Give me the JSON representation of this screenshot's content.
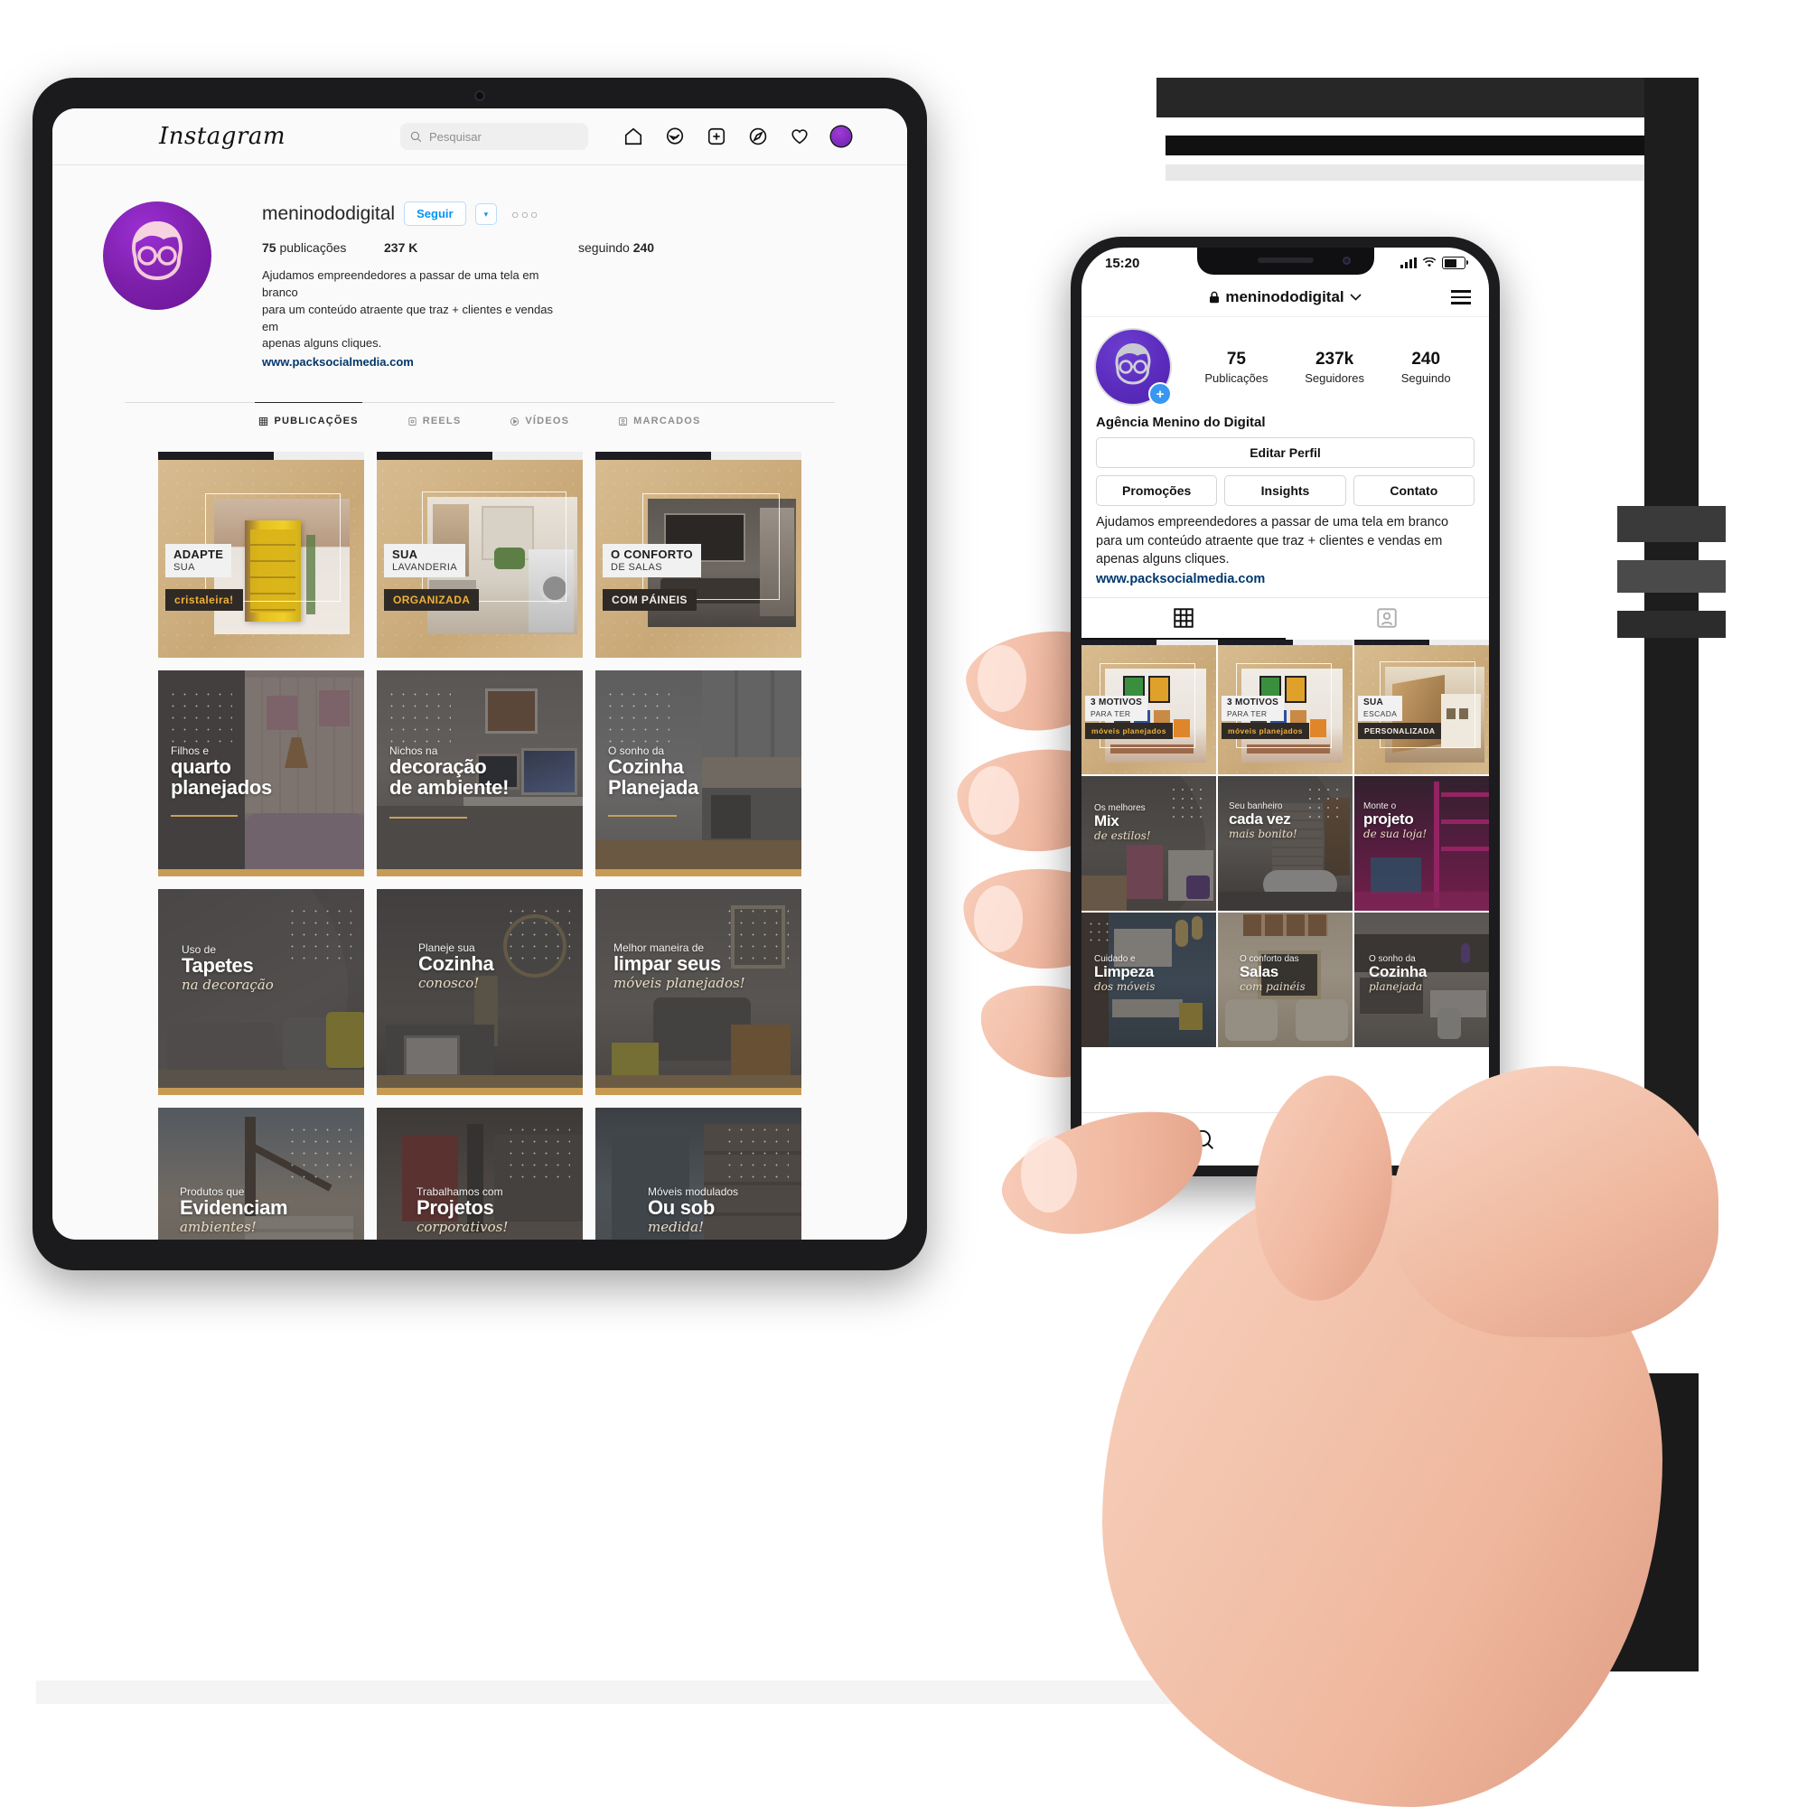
{
  "tablet": {
    "topbar": {
      "logo": "Instagram",
      "search_placeholder": "Pesquisar",
      "icons": [
        "home-icon",
        "messenger-icon",
        "new-post-icon",
        "explore-icon",
        "activity-icon",
        "profile-avatar-icon"
      ]
    },
    "profile": {
      "username": "meninododigital",
      "follow_button": "Seguir",
      "caret_button": "▾",
      "more_button": "○○○",
      "posts_count": "75",
      "posts_label": "publicações",
      "followers": "237 K",
      "following_label": "seguindo",
      "following_count": "240",
      "bio_line1": "Ajudamos empreendedores a passar de uma tela em branco",
      "bio_line2": "para um conteúdo atraente que traz + clientes e vendas em",
      "bio_line3": "apenas alguns cliques.",
      "website": "www.packsocialmedia.com"
    },
    "tabs": [
      {
        "label": "PUBLICAÇÕES",
        "icon": "grid-icon",
        "active": true
      },
      {
        "label": "REELS",
        "icon": "reels-icon",
        "active": false
      },
      {
        "label": "VÍDEOS",
        "icon": "video-icon",
        "active": false
      },
      {
        "label": "MARCADOS",
        "icon": "tagged-icon",
        "active": false
      }
    ],
    "posts": [
      {
        "style": "beige",
        "l1": "ADAPTE",
        "l2": "SUA",
        "tag": "cristaleira!",
        "tag_style": "gold"
      },
      {
        "style": "beige",
        "l1": "SUA",
        "l2": "LAVANDERIA",
        "tag": "ORGANIZADA",
        "tag_style": "gold"
      },
      {
        "style": "beige",
        "l1": "O CONFORTO",
        "l2": "DE SALAS",
        "tag": "COM PÁINEIS",
        "tag_style": "cream"
      },
      {
        "style": "gray",
        "pre": "Filhos e",
        "big": "quarto\nplanejados",
        "scr": ""
      },
      {
        "style": "gray",
        "pre": "Nichos na",
        "big": "decoração\nde ambiente!",
        "scr": ""
      },
      {
        "style": "gray",
        "pre": "O sonho da",
        "big": "Cozinha\nPlanejada",
        "scr": ""
      },
      {
        "style": "gray",
        "pre": "Uso de",
        "big": "Tapetes",
        "scr": "na decoração"
      },
      {
        "style": "gray",
        "pre": "Planeje sua",
        "big": "Cozinha",
        "scr": "conosco!"
      },
      {
        "style": "gray",
        "pre": "Melhor maneira de",
        "big": "limpar seus",
        "scr": "móveis planejados!"
      },
      {
        "style": "gray",
        "pre": "Produtos que",
        "big": "Evidenciam",
        "scr": "ambientes!"
      },
      {
        "style": "gray",
        "pre": "Trabalhamos com",
        "big": "Projetos",
        "scr": "corporativos!"
      },
      {
        "style": "gray",
        "pre": "Móveis modulados",
        "big": "Ou sob",
        "scr": "medida!"
      }
    ]
  },
  "phone": {
    "status": {
      "time": "15:20",
      "signal": "signal-bars-icon",
      "wifi": "wifi-icon",
      "battery": "battery-icon"
    },
    "header": {
      "lock": "lock-icon",
      "username": "meninododigital",
      "chevron": "⌄",
      "menu": "hamburger-menu-icon"
    },
    "profile": {
      "add_story": "+",
      "stats": [
        {
          "number": "75",
          "label": "Publicações"
        },
        {
          "number": "237k",
          "label": "Seguidores"
        },
        {
          "number": "240",
          "label": "Seguindo"
        }
      ],
      "full_name": "Agência Menino do Digital",
      "edit_profile": "Editar Perfil",
      "actions": [
        "Promoções",
        "Insights",
        "Contato"
      ],
      "bio_line1": "Ajudamos empreendedores a passar de uma tela em branco",
      "bio_line2": "para um conteúdo atraente que traz + clientes e vendas em",
      "bio_line3": "apenas alguns cliques.",
      "website": "www.packsocialmedia.com"
    },
    "tabs": [
      {
        "icon": "grid-icon",
        "active": true
      },
      {
        "icon": "tagged-person-icon",
        "active": false
      }
    ],
    "posts": [
      {
        "style": "beige",
        "l1": "3 MOTIVOS",
        "l2": "PARA TER",
        "tag": "móveis planejados",
        "tag_style": "gold"
      },
      {
        "style": "beige",
        "l1": "3 MOTIVOS",
        "l2": "PARA TER",
        "tag": "móveis planejados",
        "tag_style": "gold"
      },
      {
        "style": "beige",
        "l1": "SUA",
        "l2": "ESCADA",
        "tag": "PERSONALIZADA",
        "tag_style": "cream"
      },
      {
        "style": "gray",
        "pre": "Os melhores",
        "big": "Mix",
        "scr": "de estilos!"
      },
      {
        "style": "gray",
        "pre": "Seu banheiro",
        "big": "cada vez",
        "scr": "mais bonito!"
      },
      {
        "style": "gray",
        "pre": "Monte o",
        "big": "projeto",
        "scr": "de sua loja!"
      },
      {
        "style": "gray",
        "pre": "Cuidado e",
        "big": "Limpeza",
        "scr": "dos móveis"
      },
      {
        "style": "gray",
        "pre": "O conforto das",
        "big": "Salas",
        "scr": "com painéis"
      },
      {
        "style": "gray",
        "pre": "O sonho da",
        "big": "Cozinha",
        "scr": "planejada"
      }
    ],
    "tabbar": [
      "home-icon",
      "search-icon",
      "add-post-icon",
      "heart-icon",
      "profile-icon"
    ]
  },
  "colors": {
    "accent_blue": "#0095f6",
    "brand_purple": "#7b1fa8",
    "phone_purple": "#5b2bbd",
    "link_blue": "#00376b",
    "beige": "#c9a877",
    "gold": "#efb03a"
  }
}
